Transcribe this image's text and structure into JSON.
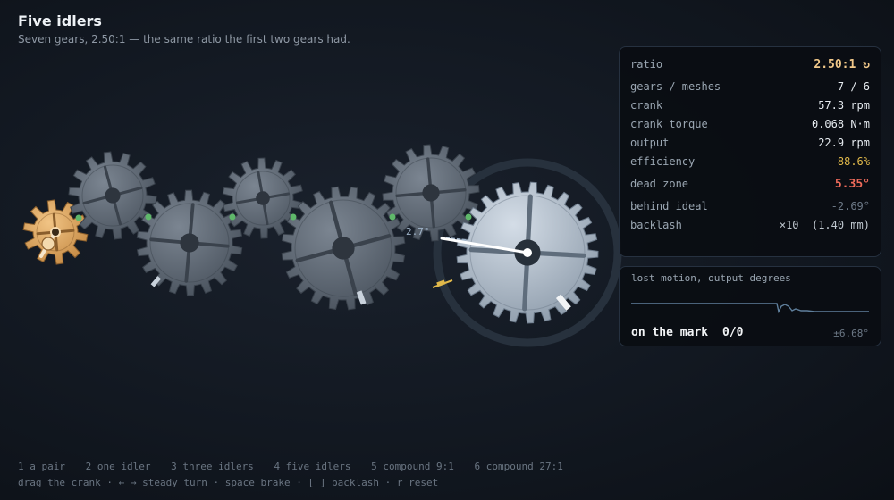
{
  "header": {
    "title": "Five idlers",
    "subtitle": "Seven gears, 2.50:1 — the same ratio the first two gears had."
  },
  "scene": {
    "angle_readout": "2.7°",
    "gears": [
      {
        "name": "crank-gear",
        "teeth": 10,
        "color": "#d9a35e"
      },
      {
        "name": "idler-1",
        "teeth": 14,
        "color": "#5b6470"
      },
      {
        "name": "idler-2",
        "teeth": 18,
        "color": "#5b6470"
      },
      {
        "name": "idler-3",
        "teeth": 14,
        "color": "#5b6470"
      },
      {
        "name": "idler-4",
        "teeth": 20,
        "color": "#5b6470"
      },
      {
        "name": "idler-5",
        "teeth": 16,
        "color": "#5b6470"
      },
      {
        "name": "output-gear",
        "teeth": 25,
        "color": "#a9b6c4"
      }
    ]
  },
  "stats": {
    "ratio": {
      "label": "ratio",
      "value": "2.50:1 ↻"
    },
    "gears_meshes": {
      "label": "gears / meshes",
      "value": "7 / 6"
    },
    "crank": {
      "label": "crank",
      "value": "57.3 rpm"
    },
    "crank_torque": {
      "label": "crank torque",
      "value": "0.068 N·m"
    },
    "output": {
      "label": "output",
      "value": "22.9 rpm"
    },
    "efficiency": {
      "label": "efficiency",
      "value": "88.6%"
    },
    "dead_zone": {
      "label": "dead zone",
      "value": "5.35°"
    },
    "behind_ideal": {
      "label": "behind ideal",
      "value": "-2.69°"
    },
    "backlash": {
      "label": "backlash",
      "value": "×10  (1.40 mm)"
    }
  },
  "trace": {
    "label": "lost motion, output degrees",
    "status": "on the mark",
    "count": "0/0",
    "tolerance": "±6.68°",
    "line_color": "#5f7f9c"
  },
  "footer": {
    "presets": [
      "1 a pair",
      "2 one idler",
      "3 three idlers",
      "4 five idlers",
      "5 compound 9:1",
      "6 compound 27:1"
    ],
    "keys": "drag the crank · ← → steady turn · space brake · [ ] backlash · r reset"
  }
}
